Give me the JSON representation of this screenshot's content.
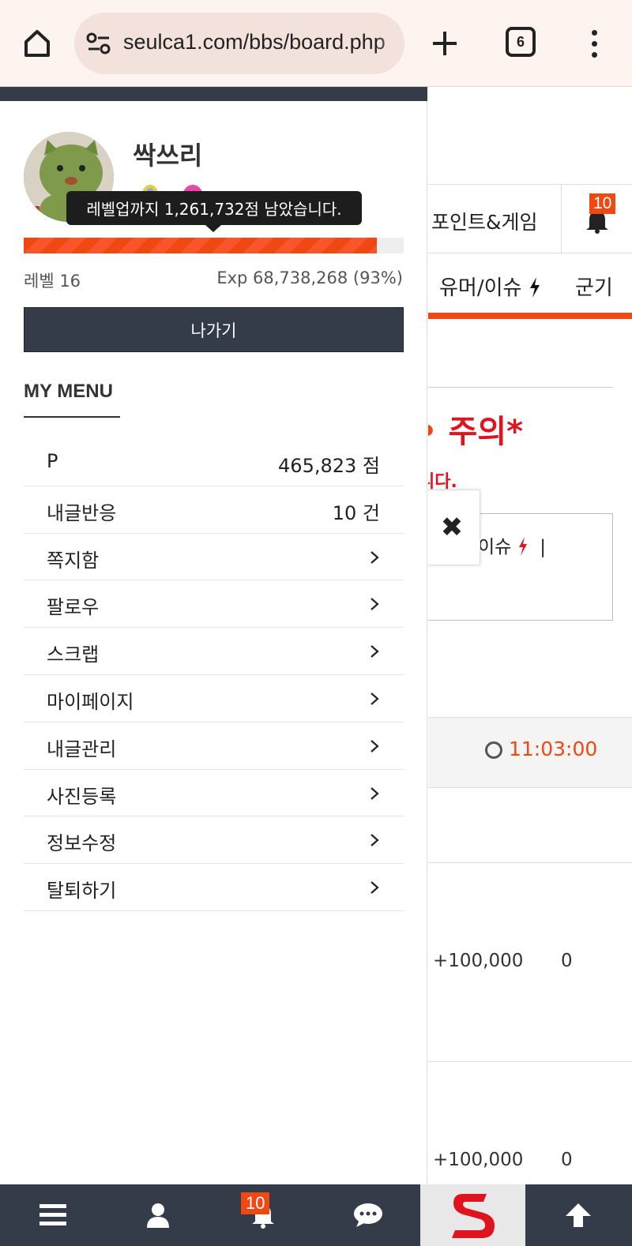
{
  "browser": {
    "url": "seulca1.com/bbs/board.php",
    "tab_count": "6"
  },
  "background_page": {
    "nav_points_game": "포인트&게임",
    "nav_bell_badge": "10",
    "nav_humor": "유머/이슈",
    "nav_military": "군기",
    "warning_title": "주의*",
    "warning_sub": "니다.",
    "box_text": "이슈",
    "box_sep": "|",
    "close_symbol": "✖",
    "time": "11:03:00",
    "rows": [
      {
        "amount": "+100,000",
        "count": "0"
      },
      {
        "amount": "+100,000",
        "count": "0"
      }
    ]
  },
  "drawer": {
    "username": "싹쓰리",
    "tooltip": "레벨업까지 1,261,732점 남았습니다.",
    "exp_progress_percent": 93,
    "level_text": "레벨 16",
    "exp_text": "Exp 68,738,268 (93%)",
    "logout_label": "나가기",
    "mymenu_title": "MY MENU",
    "menu": [
      {
        "label": "P",
        "value": "465,823 점"
      },
      {
        "label": "내글반응",
        "value": "10 건"
      },
      {
        "label": "쪽지함",
        "value": null
      },
      {
        "label": "팔로우",
        "value": null
      },
      {
        "label": "스크랩",
        "value": null
      },
      {
        "label": "마이페이지",
        "value": null
      },
      {
        "label": "내글관리",
        "value": null
      },
      {
        "label": "사진등록",
        "value": null
      },
      {
        "label": "정보수정",
        "value": null
      },
      {
        "label": "탈퇴하기",
        "value": null
      }
    ]
  },
  "bottom_nav": {
    "bell_badge": "10",
    "items": [
      "menu-icon",
      "user-icon",
      "bell-icon",
      "chat-icon",
      "site-logo",
      "arrow-up-icon"
    ]
  },
  "colors": {
    "accent": "#f04812",
    "dark": "#333c48",
    "warning_red": "#e0141e"
  }
}
